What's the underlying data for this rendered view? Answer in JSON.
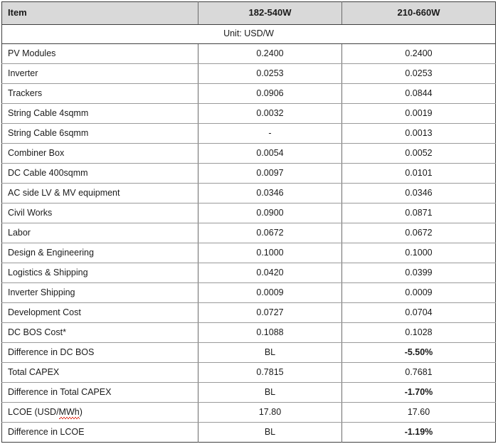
{
  "table": {
    "header": {
      "item_label": "Item",
      "columns": [
        "182-540W",
        "210-660W"
      ]
    },
    "unit_banner": "Unit: USD/W",
    "rows": [
      {
        "item": "PV Modules",
        "v182": "0.2400",
        "v210": "0.2400",
        "bold182": false,
        "bold210": false
      },
      {
        "item": "Inverter",
        "v182": "0.0253",
        "v210": "0.0253",
        "bold182": false,
        "bold210": false
      },
      {
        "item": "Trackers",
        "v182": "0.0906",
        "v210": "0.0844",
        "bold182": false,
        "bold210": false
      },
      {
        "item": "String Cable 4sqmm",
        "v182": "0.0032",
        "v210": "0.0019",
        "bold182": false,
        "bold210": false
      },
      {
        "item": "String Cable 6sqmm",
        "v182": "-",
        "v210": "0.0013",
        "bold182": false,
        "bold210": false
      },
      {
        "item": "Combiner Box",
        "v182": "0.0054",
        "v210": "0.0052",
        "bold182": false,
        "bold210": false
      },
      {
        "item": "DC Cable 400sqmm",
        "v182": "0.0097",
        "v210": "0.0101",
        "bold182": false,
        "bold210": false
      },
      {
        "item": "AC side LV & MV equipment",
        "v182": "0.0346",
        "v210": "0.0346",
        "bold182": false,
        "bold210": false
      },
      {
        "item": "Civil Works",
        "v182": "0.0900",
        "v210": "0.0871",
        "bold182": false,
        "bold210": false
      },
      {
        "item": "Labor",
        "v182": "0.0672",
        "v210": "0.0672",
        "bold182": false,
        "bold210": false
      },
      {
        "item": "Design & Engineering",
        "v182": "0.1000",
        "v210": "0.1000",
        "bold182": false,
        "bold210": false
      },
      {
        "item": "Logistics & Shipping",
        "v182": "0.0420",
        "v210": "0.0399",
        "bold182": false,
        "bold210": false
      },
      {
        "item": "Inverter Shipping",
        "v182": "0.0009",
        "v210": "0.0009",
        "bold182": false,
        "bold210": false
      },
      {
        "item": "Development Cost",
        "v182": "0.0727",
        "v210": "0.0704",
        "bold182": false,
        "bold210": false
      },
      {
        "item": "DC BOS Cost*",
        "v182": "0.1088",
        "v210": "0.1028",
        "bold182": false,
        "bold210": false
      },
      {
        "item": "Difference in DC BOS",
        "v182": "BL",
        "v210": "-5.50%",
        "bold182": false,
        "bold210": true
      },
      {
        "item": "Total CAPEX",
        "v182": "0.7815",
        "v210": "0.7681",
        "bold182": false,
        "bold210": false
      },
      {
        "item": "Difference in Total CAPEX",
        "v182": "BL",
        "v210": "-1.70%",
        "bold182": false,
        "bold210": true
      },
      {
        "item": "LCOE (USD/MWh)",
        "v182": "17.80",
        "v210": "17.60",
        "bold182": false,
        "bold210": false,
        "spellcheck_fragment": "MWh",
        "item_prefix": "LCOE (USD/",
        "item_suffix": ")"
      },
      {
        "item": "Difference in LCOE",
        "v182": "BL",
        "v210": "-1.19%",
        "bold182": false,
        "bold210": true
      }
    ]
  },
  "colors": {
    "header_background": "#d9d9d9",
    "outer_border": "#3f3f3f",
    "inner_rule": "#9a9a9a",
    "column_rule": "#6b6b6b",
    "text": "#1a1a1a",
    "spellcheck_underline": "#e03020"
  }
}
